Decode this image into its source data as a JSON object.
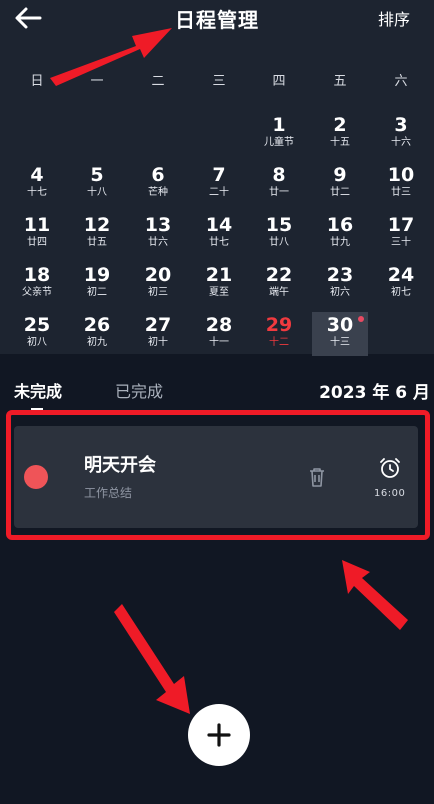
{
  "header": {
    "title": "日程管理",
    "sort_label": "排序",
    "back_icon": "arrow-left-icon"
  },
  "calendar": {
    "weekdays": [
      "日",
      "一",
      "二",
      "三",
      "四",
      "五",
      "六"
    ],
    "days": [
      {
        "num": "1",
        "lunar": "儿童节"
      },
      {
        "num": "2",
        "lunar": "十五"
      },
      {
        "num": "3",
        "lunar": "十六"
      },
      {
        "num": "4",
        "lunar": "十七"
      },
      {
        "num": "5",
        "lunar": "十八"
      },
      {
        "num": "6",
        "lunar": "芒种"
      },
      {
        "num": "7",
        "lunar": "二十"
      },
      {
        "num": "8",
        "lunar": "廿一"
      },
      {
        "num": "9",
        "lunar": "廿二"
      },
      {
        "num": "10",
        "lunar": "廿三"
      },
      {
        "num": "11",
        "lunar": "廿四"
      },
      {
        "num": "12",
        "lunar": "廿五"
      },
      {
        "num": "13",
        "lunar": "廿六"
      },
      {
        "num": "14",
        "lunar": "廿七"
      },
      {
        "num": "15",
        "lunar": "廿八"
      },
      {
        "num": "16",
        "lunar": "廿九"
      },
      {
        "num": "17",
        "lunar": "三十"
      },
      {
        "num": "18",
        "lunar": "父亲节"
      },
      {
        "num": "19",
        "lunar": "初二"
      },
      {
        "num": "20",
        "lunar": "初三"
      },
      {
        "num": "21",
        "lunar": "夏至"
      },
      {
        "num": "22",
        "lunar": "端午"
      },
      {
        "num": "23",
        "lunar": "初六"
      },
      {
        "num": "24",
        "lunar": "初七"
      },
      {
        "num": "25",
        "lunar": "初八"
      },
      {
        "num": "26",
        "lunar": "初九"
      },
      {
        "num": "27",
        "lunar": "初十"
      },
      {
        "num": "28",
        "lunar": "十一"
      },
      {
        "num": "29",
        "lunar": "十二"
      },
      {
        "num": "30",
        "lunar": "十三"
      }
    ],
    "holiday_color": "#f03a3f",
    "today_dot_color": "#e84a62"
  },
  "tabs": {
    "incomplete": "未完成",
    "completed": "已完成"
  },
  "month_label": "2023 年 6 月",
  "task": {
    "title": "明天开会",
    "subtitle": "工作总结",
    "alarm_time": "16:00",
    "dot_color": "#ef5458",
    "trash_icon": "trash-icon",
    "alarm_icon": "alarm-clock-icon"
  },
  "fab": {
    "icon": "plus-icon"
  },
  "annotation_color": "#ef1b27"
}
